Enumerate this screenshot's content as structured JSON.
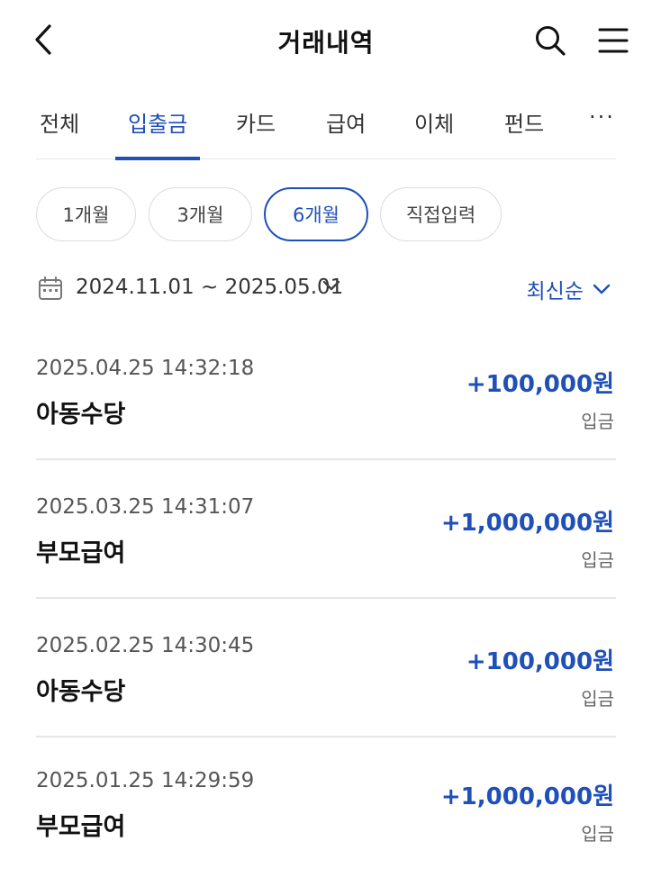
{
  "header": {
    "title": "거래내역"
  },
  "tabs": [
    {
      "label": "전체",
      "active": false
    },
    {
      "label": "입출금",
      "active": true
    },
    {
      "label": "카드",
      "active": false
    },
    {
      "label": "급여",
      "active": false
    },
    {
      "label": "이체",
      "active": false
    },
    {
      "label": "펀드",
      "active": false
    }
  ],
  "tabs_more_label": "···",
  "period_chips": [
    {
      "label": "1개월",
      "selected": false
    },
    {
      "label": "3개월",
      "selected": false
    },
    {
      "label": "6개월",
      "selected": true
    },
    {
      "label": "직접입력",
      "selected": false
    }
  ],
  "date_range": {
    "text": "2024.11.01 ~ 2025.05.01"
  },
  "sort": {
    "label": "최신순"
  },
  "transactions": [
    {
      "datetime": "2025.04.25 14:32:18",
      "name": "아동수당",
      "amount": "+100,000원",
      "type": "입금"
    },
    {
      "datetime": "2025.03.25 14:31:07",
      "name": "부모급여",
      "amount": "+1,000,000원",
      "type": "입금"
    },
    {
      "datetime": "2025.02.25 14:30:45",
      "name": "아동수당",
      "amount": "+100,000원",
      "type": "입금"
    },
    {
      "datetime": "2025.01.25 14:29:59",
      "name": "부모급여",
      "amount": "+1,000,000원",
      "type": "입금"
    }
  ],
  "colors": {
    "accent": "#1f4fb8",
    "divider": "#e6e6ea",
    "text": "#111111"
  },
  "icons": {
    "back": "chevron-left-icon",
    "search": "search-icon",
    "menu": "hamburger-menu-icon",
    "calendar": "calendar-icon",
    "dropdown": "chevron-down-icon"
  }
}
